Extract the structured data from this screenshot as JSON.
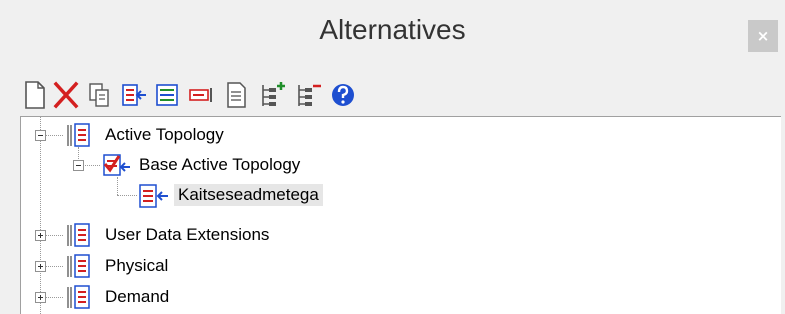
{
  "panel": {
    "title": "Alternatives",
    "close_label": "×"
  },
  "toolbar": {
    "buttons": [
      {
        "name": "new-icon"
      },
      {
        "name": "delete-icon"
      },
      {
        "name": "copy-icon"
      },
      {
        "name": "activate-icon"
      },
      {
        "name": "compare-icon"
      },
      {
        "name": "deactivate-icon"
      },
      {
        "name": "report-icon"
      },
      {
        "name": "add-child-icon"
      },
      {
        "name": "remove-child-icon"
      },
      {
        "name": "help-icon"
      }
    ],
    "colors": {
      "red": "#d42020",
      "blue": "#1e4fd0",
      "green": "#1f8f2a",
      "gray": "#555555"
    }
  },
  "tree": {
    "nodes": [
      {
        "label": "Active Topology",
        "expanded": true
      },
      {
        "label": "Base Active Topology",
        "expanded": true
      },
      {
        "label": "Kaitseseadmetega",
        "selected": true
      },
      {
        "label": "User Data Extensions",
        "expanded": false
      },
      {
        "label": "Physical",
        "expanded": false
      },
      {
        "label": "Demand",
        "expanded": false
      }
    ]
  }
}
